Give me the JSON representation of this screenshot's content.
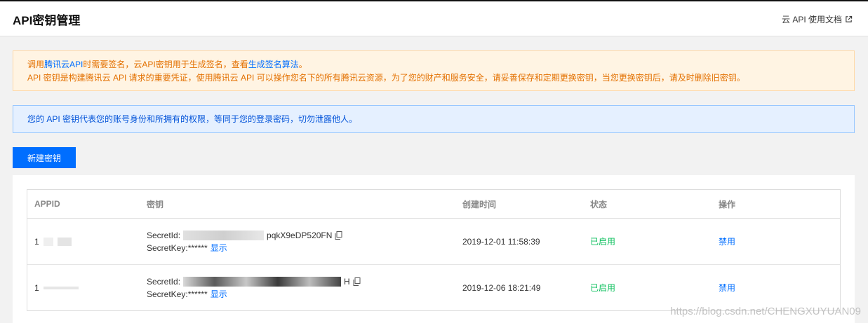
{
  "header": {
    "title": "API密钥管理",
    "doc_link": "云 API 使用文档"
  },
  "warning": {
    "line1_prefix": "调用",
    "line1_link1": "腾讯云API",
    "line1_mid": "时需要签名，云API密钥用于生成签名，查看",
    "line1_link2": "生成签名算法",
    "line1_suffix": "。",
    "line2": "API 密钥是构建腾讯云 API 请求的重要凭证，使用腾讯云 API 可以操作您名下的所有腾讯云资源，为了您的财产和服务安全，请妥善保存和定期更换密钥，当您更换密钥后，请及时删除旧密钥。"
  },
  "info": {
    "text": "您的 API 密钥代表您的账号身份和所拥有的权限，等同于您的登录密码，切勿泄露他人。"
  },
  "actions": {
    "new_key": "新建密钥"
  },
  "table": {
    "columns": [
      "APPID",
      "密钥",
      "创建时间",
      "状态",
      "操作"
    ],
    "rows": [
      {
        "appid": "1",
        "secret_id_label": "SecretId:",
        "secret_id_suffix": "pqkX9eDP520FN",
        "secret_key_label": "SecretKey:******",
        "show": "显示",
        "created": "2019-12-01 11:58:39",
        "status": "已启用",
        "action": "禁用"
      },
      {
        "appid": "1",
        "secret_id_label": "SecretId:",
        "secret_id_suffix": "H",
        "secret_key_label": "SecretKey:******",
        "show": "显示",
        "created": "2019-12-06 18:21:49",
        "status": "已启用",
        "action": "禁用"
      }
    ]
  },
  "watermark": "https://blog.csdn.net/CHENGXUYUAN09",
  "colors": {
    "primary": "#006eff",
    "warning_text": "#e37000",
    "info_text": "#0052d9",
    "enabled_status": "#0abf5b"
  }
}
